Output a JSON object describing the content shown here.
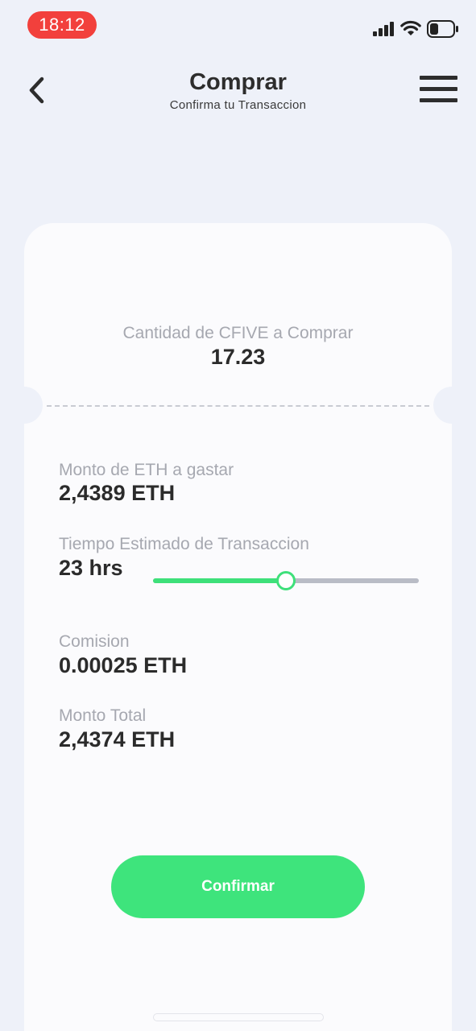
{
  "status_bar": {
    "time": "18:12",
    "icons": [
      "signal-icon",
      "wifi-icon",
      "battery-icon"
    ]
  },
  "header": {
    "title": "Comprar",
    "subtitle": "Confirma tu Transaccion",
    "icons": [
      "back-arrow-icon",
      "hamburger-menu-icon"
    ]
  },
  "purchase": {
    "quantity_label": "Cantidad de CFIVE a Comprar",
    "quantity_value": "17.23"
  },
  "details": {
    "eth_amount_label": "Monto de ETH a gastar",
    "eth_amount_value": "2,4389 ETH",
    "time_label": "Tiempo Estimado de Transaccion",
    "time_value": "23 hrs",
    "time_slider_level": 0.5,
    "fee_label": "Comision",
    "fee_value": "0.00025 ETH",
    "total_label": "Monto Total",
    "total_value": "2,4374 ETH"
  },
  "actions": {
    "confirm_label": "Confirmar"
  },
  "colors": {
    "accent": "#3ee47c",
    "time_pill": "#f2403c",
    "background": "#eef1f9",
    "card": "#fbfbfd",
    "label": "#a6a8b0",
    "text": "#2b2b2b"
  }
}
